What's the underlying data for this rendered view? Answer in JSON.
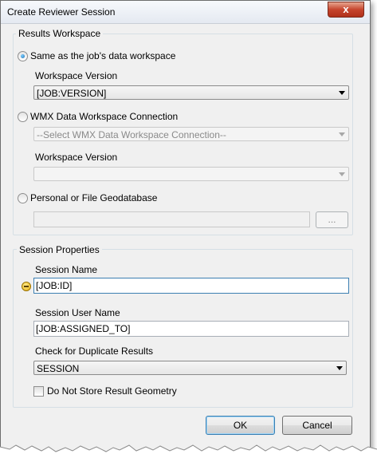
{
  "window": {
    "title": "Create Reviewer Session",
    "close_glyph": "x"
  },
  "results_workspace": {
    "group_title": "Results Workspace",
    "option_same": {
      "label": "Same as the job's data workspace",
      "checked": true
    },
    "same_workspace_version_label": "Workspace Version",
    "same_workspace_version_value": "[JOB:VERSION]",
    "option_wmx": {
      "label": "WMX Data Workspace Connection",
      "checked": false
    },
    "wmx_connection_value": "--Select WMX Data Workspace Connection--",
    "wmx_workspace_version_label": "Workspace Version",
    "wmx_workspace_version_value": "",
    "option_gdb": {
      "label": "Personal or File Geodatabase",
      "checked": false
    },
    "gdb_path_value": "",
    "browse_label": "..."
  },
  "session_properties": {
    "group_title": "Session Properties",
    "session_name_label": "Session Name",
    "session_name_value": "[JOB:ID]",
    "session_user_label": "Session User Name",
    "session_user_value": "[JOB:ASSIGNED_TO]",
    "duplicate_label": "Check for Duplicate Results",
    "duplicate_value": "SESSION",
    "no_geometry_label": "Do Not Store Result Geometry",
    "no_geometry_checked": false
  },
  "buttons": {
    "ok": "OK",
    "cancel": "Cancel"
  },
  "icons": {
    "close": "close-icon",
    "warning": "warning-icon",
    "dropdown": "chevron-down-icon"
  }
}
